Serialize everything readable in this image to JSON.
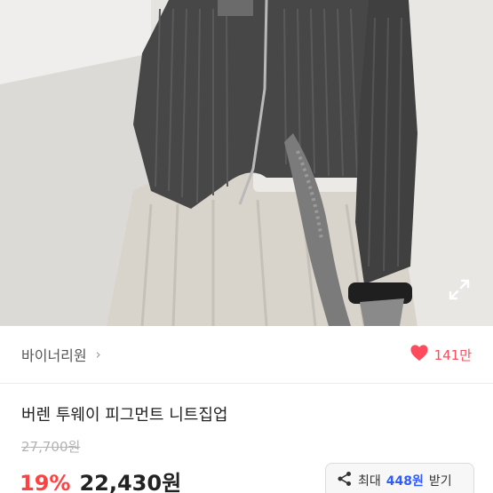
{
  "shop": {
    "name": "바이너리원",
    "chevron": "›"
  },
  "like": {
    "count": "141만",
    "icon": "heart-icon",
    "color": "#ff4b5c"
  },
  "product": {
    "title": "버렌 투웨이 피그먼트 니트집업",
    "original_price": "27,700원",
    "discount": "19%",
    "price": "22,430원"
  },
  "coupon": {
    "prefix": "최대",
    "amount": "448원",
    "suffix": "받기",
    "icon": "share-icon"
  },
  "colors": {
    "discount": "#ff4141",
    "coupon_amount": "#2f5bff"
  }
}
